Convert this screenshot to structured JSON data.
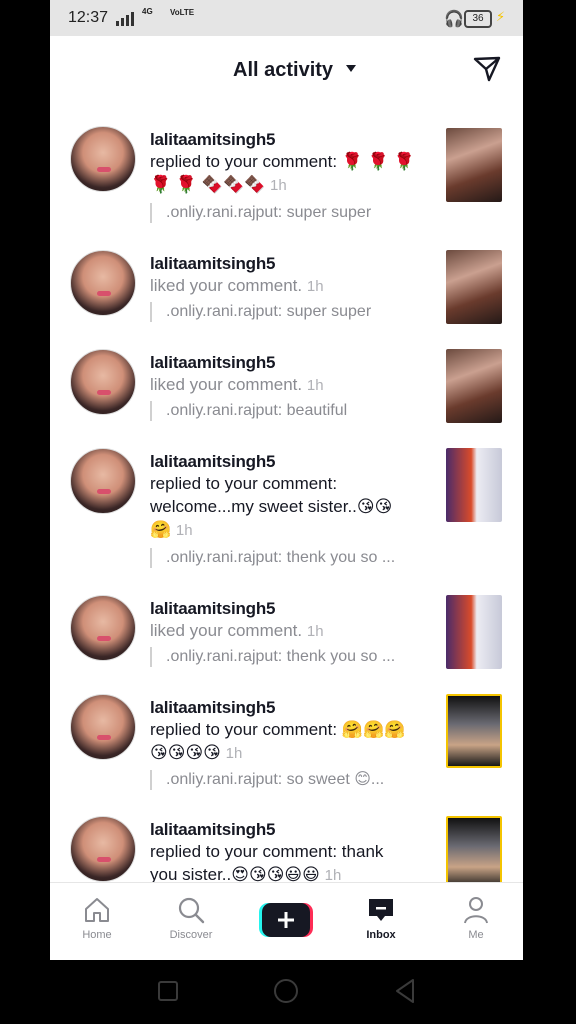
{
  "status": {
    "time": "12:37",
    "net": "4G",
    "volte": "VoLTE",
    "battery": "36"
  },
  "header": {
    "title": "All activity"
  },
  "items": [
    {
      "user": "lalitaamitsingh5",
      "line1": "replied to your comment: 🌹 🌹 🌹",
      "line2": "🌹 🌹 🍫🍫🍫",
      "ago": "1h",
      "quote": ".onliy.rani.rajput: super super"
    },
    {
      "user": "lalitaamitsingh5",
      "line1": "liked your comment.",
      "ago": "1h",
      "quote": ".onliy.rani.rajput: super super"
    },
    {
      "user": "lalitaamitsingh5",
      "line1": "liked your comment.",
      "ago": "1h",
      "quote": ".onliy.rani.rajput: beautiful"
    },
    {
      "user": "lalitaamitsingh5",
      "line1": "replied to your comment:",
      "line2": "welcome...my sweet sister..😘😘",
      "line3": "🤗",
      "ago": "1h",
      "quote": ".onliy.rani.rajput: thenk you so ..."
    },
    {
      "user": "lalitaamitsingh5",
      "line1": "liked your comment.",
      "ago": "1h",
      "quote": ".onliy.rani.rajput: thenk you so ..."
    },
    {
      "user": "lalitaamitsingh5",
      "line1": "replied to your comment: 🤗🤗🤗",
      "line2": "😘😘😘😘",
      "ago": "1h",
      "quote": ".onliy.rani.rajput: so sweet 😊..."
    },
    {
      "user": "lalitaamitsingh5",
      "line1": "replied to your comment: thank",
      "line2": "you sister..😍😘😘😃😃",
      "ago": "1h"
    }
  ],
  "tabs": {
    "home": "Home",
    "discover": "Discover",
    "inbox": "Inbox",
    "me": "Me"
  }
}
